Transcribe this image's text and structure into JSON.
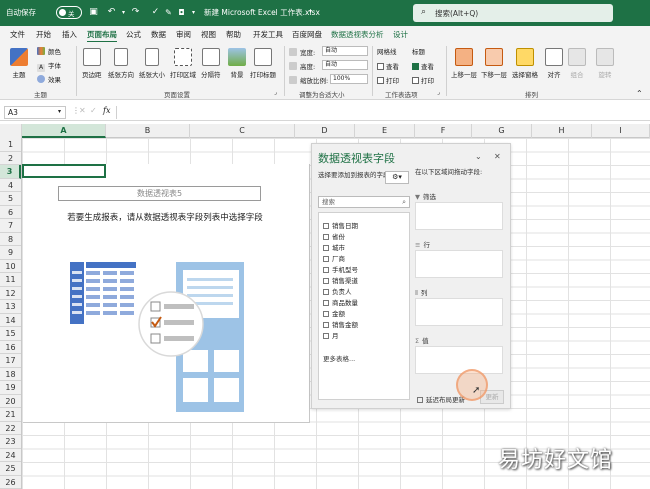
{
  "titlebar": {
    "autosave_label": "自动保存",
    "autosave_state": "关",
    "doc_title": "新建 Microsoft Excel 工作表.xlsx",
    "search_placeholder": "搜索(Alt+Q)",
    "bg_color": "#1e7145"
  },
  "menu": {
    "tabs": [
      "文件",
      "开始",
      "插入",
      "页面布局",
      "公式",
      "数据",
      "审阅",
      "视图",
      "帮助",
      "开发工具",
      "百度网盘",
      "数据透视表分析",
      "设计"
    ],
    "active_tab": "页面布局"
  },
  "ribbon": {
    "theme": {
      "main": "主题",
      "colors": "颜色",
      "fonts": "字体",
      "effects": "效果",
      "group": "主题"
    },
    "page_setup": {
      "margins": "页边距",
      "orientation": "纸张方向",
      "size": "纸张大小",
      "print_area": "打印区域",
      "breaks": "分隔符",
      "background": "背景",
      "print_titles": "打印标题",
      "group": "页面设置"
    },
    "scale": {
      "width_label": "宽度:",
      "width_value": "自动",
      "height_label": "高度:",
      "height_value": "自动",
      "scale_label": "缩放比例:",
      "scale_value": "100%",
      "group": "调整为合适大小"
    },
    "sheet_options": {
      "gridlines": "网格线",
      "headings": "标题",
      "view": "查看",
      "print": "打印",
      "group": "工作表选项"
    },
    "arrange": {
      "bring_forward": "上移一层",
      "send_backward": "下移一层",
      "selection_pane": "选择窗格",
      "align": "对齐",
      "group_btn": "组合",
      "rotate": "旋转",
      "group": "排列"
    }
  },
  "formula_bar": {
    "name_box": "A3",
    "fx": "fx"
  },
  "grid": {
    "columns": [
      "A",
      "B",
      "C",
      "D",
      "E",
      "F",
      "G",
      "H",
      "I"
    ],
    "rows": [
      "1",
      "2",
      "3",
      "4",
      "5",
      "6",
      "7",
      "8",
      "9",
      "10",
      "11",
      "12",
      "13",
      "14",
      "15",
      "16",
      "17",
      "18",
      "19",
      "20",
      "21",
      "22",
      "23",
      "24",
      "25",
      "26"
    ],
    "selected_col": "A",
    "selected_row": "3"
  },
  "pivot_placeholder": {
    "name": "数据透视表5",
    "message": "若要生成报表，请从数据透视表字段列表中选择字段"
  },
  "pane": {
    "title": "数据透视表字段",
    "choose_label": "选择要添加到报表的字段:",
    "search_placeholder": "搜索",
    "fields": [
      "销售日期",
      "省份",
      "城市",
      "厂商",
      "手机型号",
      "销售渠道",
      "负责人",
      "商品数量",
      "金额",
      "销售金额",
      "月"
    ],
    "more_tables": "更多表格...",
    "drag_tip": "在以下区域间拖动字段:",
    "areas": {
      "filters": "筛选",
      "columns": "列",
      "rows": "行",
      "values": "值"
    },
    "defer_label": "延迟布局更新",
    "update_btn": "更新"
  },
  "watermark": "易坊好文馆"
}
